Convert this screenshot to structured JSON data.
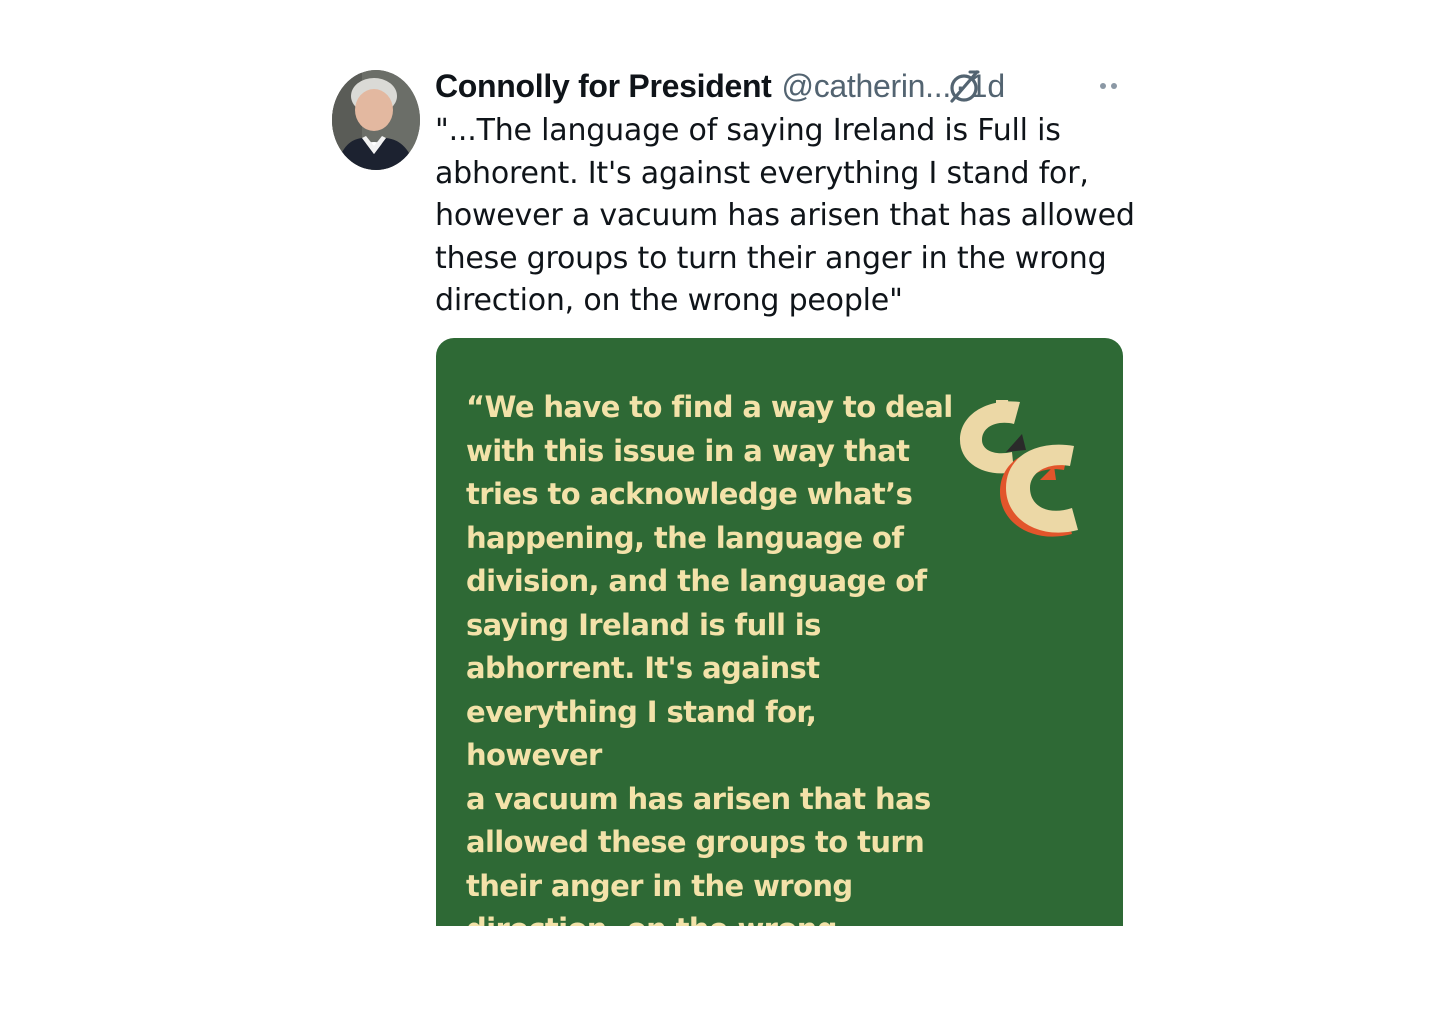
{
  "tweet": {
    "display_name": "Connolly for President",
    "handle": "@catherin...",
    "separator": "·",
    "timestamp": "1d",
    "text": "\"...The language of saying Ireland is Full is\nabhorent. It's against everything I stand for,\nhowever a vacuum has arisen that has allowed\nthese groups  to turn their anger in the wrong\ndirection, on the wrong people\"",
    "icons": {
      "grok": "grok-icon",
      "more": "more-icon"
    }
  },
  "media_card": {
    "quote": "“We have to find a way to deal\nwith this issue in a way that\ntries to acknowledge what’s\nhappening, the language of\ndivision, and the language of\nsaying Ireland is full is\nabhorrent. It's against\neverything I stand for, however\na vacuum has arisen that has\nallowed these groups to turn\ntheir anger in the wrong\ndirection, on the wrong people.”",
    "logo": "CC",
    "colors": {
      "background": "#2e6935",
      "text": "#f3e2a9",
      "logo_fill": "#ecd8a6",
      "logo_accent": "#e2552b"
    }
  }
}
